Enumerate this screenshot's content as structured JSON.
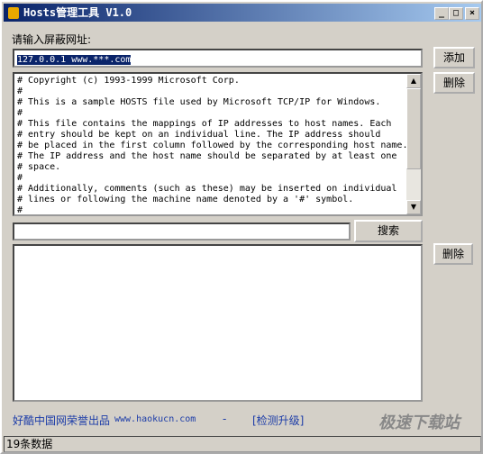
{
  "title": "Hosts管理工具 V1.0",
  "prompt_label": "请输入屏蔽网址:",
  "url_input": "127.0.0.1 www.***.com",
  "add_button": "添加",
  "delete_button": "删除",
  "delete_button2": "删除",
  "search_button": "搜索",
  "search_input": "",
  "hosts_text": "# Copyright (c) 1993-1999 Microsoft Corp.\n#\n# This is a sample HOSTS file used by Microsoft TCP/IP for Windows.\n#\n# This file contains the mappings of IP addresses to host names. Each\n# entry should be kept on an individual line. The IP address should\n# be placed in the first column followed by the corresponding host name.\n# The IP address and the host name should be separated by at least one\n# space.\n#\n# Additionally, comments (such as these) may be inserted on individual\n# lines or following the machine name denoted by a '#' symbol.\n#",
  "footer": {
    "credit": "好酷中国网荣誉出品",
    "site": "www.haokucn.com",
    "dash": "-",
    "update_link": "[检测升级]",
    "watermark": "极速下载站"
  },
  "status": "19条数据",
  "colors": {
    "title_bar": "#0a246a",
    "link": "#1c3ca8",
    "selection": "#0a246a"
  }
}
